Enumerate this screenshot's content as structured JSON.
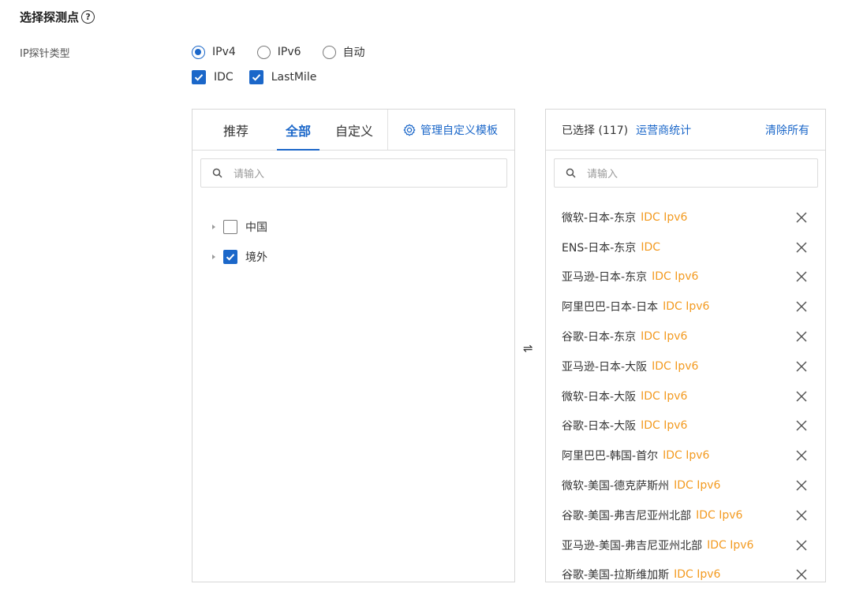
{
  "header": {
    "title": "选择探测点",
    "help_icon": "?"
  },
  "ip_type": {
    "label": "IP探针类型",
    "options": [
      {
        "label": "IPv4",
        "selected": true
      },
      {
        "label": "IPv6",
        "selected": false
      },
      {
        "label": "自动",
        "selected": false
      }
    ]
  },
  "probe_types": [
    {
      "label": "IDC",
      "checked": true
    },
    {
      "label": "LastMile",
      "checked": true
    }
  ],
  "left_panel": {
    "tabs": [
      {
        "label": "推荐",
        "active": false
      },
      {
        "label": "全部",
        "active": true
      },
      {
        "label": "自定义",
        "active": false
      }
    ],
    "manage_label": "管理自定义模板",
    "search_placeholder": "请输入",
    "tree": [
      {
        "label": "中国",
        "checked": false
      },
      {
        "label": "境外",
        "checked": true
      }
    ]
  },
  "transfer_icon": "⇌",
  "right_panel": {
    "selected_label": "已选择 (117)",
    "carrier_stats": "运营商统计",
    "clear_all": "清除所有",
    "search_placeholder": "请输入",
    "items": [
      {
        "name": "微软-日本-东京",
        "tag": "IDC Ipv6"
      },
      {
        "name": "ENS-日本-东京",
        "tag": "IDC"
      },
      {
        "name": "亚马逊-日本-东京",
        "tag": "IDC Ipv6"
      },
      {
        "name": "阿里巴巴-日本-日本",
        "tag": "IDC Ipv6"
      },
      {
        "name": "谷歌-日本-东京",
        "tag": "IDC Ipv6"
      },
      {
        "name": "亚马逊-日本-大阪",
        "tag": "IDC Ipv6"
      },
      {
        "name": "微软-日本-大阪",
        "tag": "IDC Ipv6"
      },
      {
        "name": "谷歌-日本-大阪",
        "tag": "IDC Ipv6"
      },
      {
        "name": "阿里巴巴-韩国-首尔",
        "tag": "IDC Ipv6"
      },
      {
        "name": "微软-美国-德克萨斯州",
        "tag": "IDC Ipv6"
      },
      {
        "name": "谷歌-美国-弗吉尼亚州北部",
        "tag": "IDC Ipv6"
      },
      {
        "name": "亚马逊-美国-弗吉尼亚州北部",
        "tag": "IDC Ipv6"
      },
      {
        "name": "谷歌-美国-拉斯维加斯",
        "tag": "IDC Ipv6"
      }
    ]
  },
  "colors": {
    "accent": "#1b67c9",
    "tag": "#f39a1f"
  }
}
